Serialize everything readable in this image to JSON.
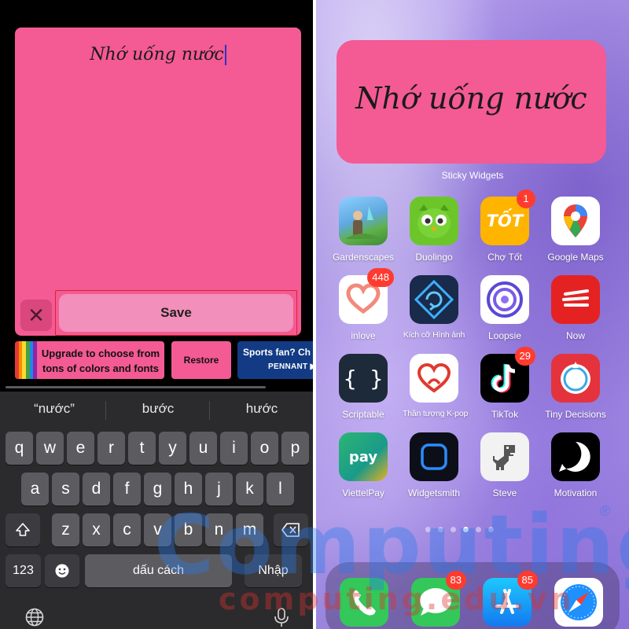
{
  "editor": {
    "note_text": "Nhớ uống nước",
    "save_label": "Save",
    "close_symbol": "✕"
  },
  "banners": {
    "upgrade_line1": "Upgrade to choose from",
    "upgrade_line2": "tons of colors and fonts",
    "restore": "Restore",
    "sports_line1": "Sports fan? Ch",
    "sports_line2": "PENNANT"
  },
  "keyboard": {
    "suggestions": [
      "“nước”",
      "bước",
      "hước"
    ],
    "row1": [
      "q",
      "w",
      "e",
      "r",
      "t",
      "y",
      "u",
      "i",
      "o",
      "p"
    ],
    "row2": [
      "a",
      "s",
      "d",
      "f",
      "g",
      "h",
      "j",
      "k",
      "l"
    ],
    "row3": [
      "z",
      "x",
      "c",
      "v",
      "b",
      "n",
      "m"
    ],
    "num_key": "123",
    "space": "dấu cách",
    "return": "Nhập",
    "icons": [
      "shift-icon",
      "backspace-icon",
      "emoji-icon",
      "globe-icon",
      "microphone-icon"
    ]
  },
  "home": {
    "widget_text": "Nhớ uống nước",
    "widget_label": "Sticky Widgets",
    "apps": [
      {
        "label": "Gardenscapes"
      },
      {
        "label": "Duolingo"
      },
      {
        "label": "Chợ Tốt",
        "badge": "1",
        "icon_text": "TỐT"
      },
      {
        "label": "Google Maps"
      },
      {
        "label": "inlove",
        "badge": "448"
      },
      {
        "label": "Kích cỡ Hình ảnh"
      },
      {
        "label": "Loopsie"
      },
      {
        "label": "Now"
      },
      {
        "label": "Scriptable",
        "icon_text": "{ }"
      },
      {
        "label": "Thần tượng K-pop"
      },
      {
        "label": "TikTok",
        "badge": "29"
      },
      {
        "label": "Tiny Decisions"
      },
      {
        "label": "ViettelPay",
        "icon_text": "pay"
      },
      {
        "label": "Widgetsmith"
      },
      {
        "label": "Steve"
      },
      {
        "label": "Motivation"
      }
    ],
    "dock": [
      {
        "name": "phone"
      },
      {
        "name": "messages",
        "badge": "83"
      },
      {
        "name": "app-store",
        "badge": "85"
      },
      {
        "name": "safari"
      }
    ],
    "page_dots": 6,
    "active_page": 3
  },
  "watermark": {
    "main": "Computing",
    "sub": "computing.edu.vn",
    "reg": "®"
  },
  "colors": {
    "note_pink": "#f45a93",
    "save_pink": "#f28fbb",
    "badge_red": "#ff3b30",
    "keyboard_bg": "#2b2b2e",
    "key_bg": "#5c5c60"
  }
}
